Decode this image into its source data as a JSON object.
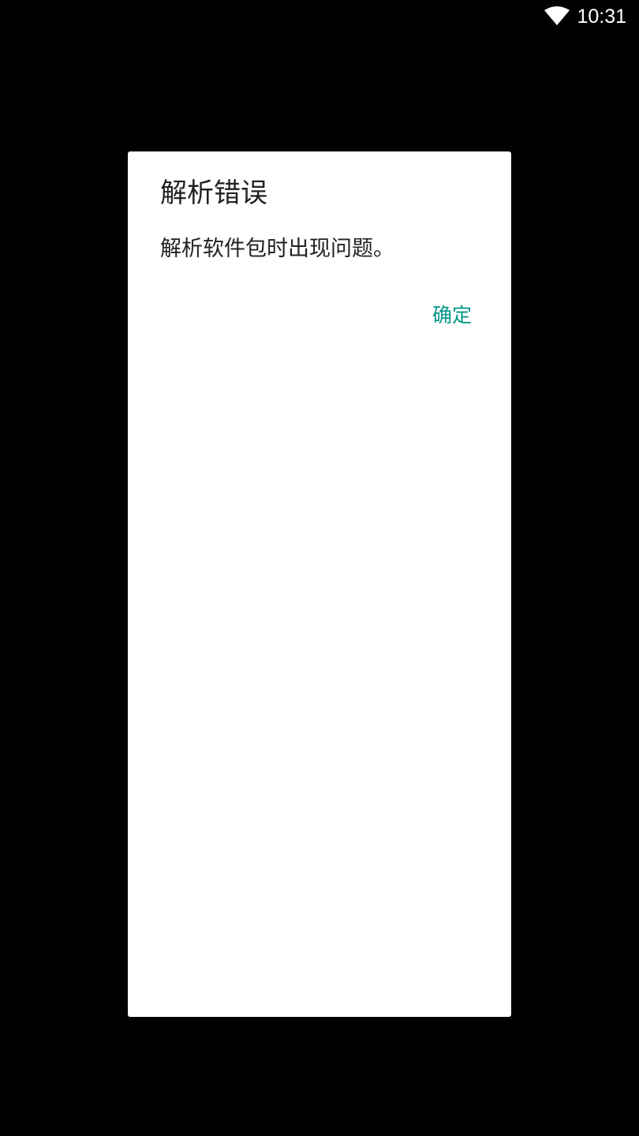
{
  "status_bar": {
    "wifi_icon": "wifi-icon",
    "time": "10:31"
  },
  "dialog": {
    "title": "解析错误",
    "message": "解析软件包时出现问题。",
    "ok_label": "确定",
    "accent_color": "#009688"
  }
}
